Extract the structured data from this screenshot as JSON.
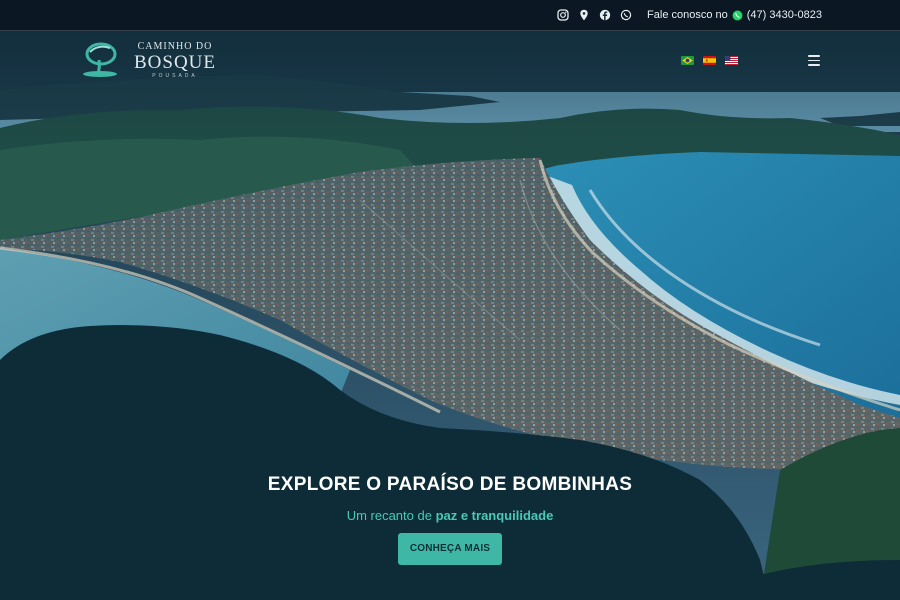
{
  "topbar": {
    "icons": [
      "instagram-icon",
      "map-pin-icon",
      "facebook-icon",
      "whatsapp-icon"
    ],
    "contact_label": "Fale conosco no",
    "contact_icon": "whatsapp-icon",
    "phone": "(47) 3430-0823"
  },
  "logo": {
    "line1": "CAMINHO DO",
    "line2": "BOSQUE",
    "line3": "POUSADA"
  },
  "languages": [
    {
      "name": "Português",
      "icon": "brazil-flag-icon"
    },
    {
      "name": "Español",
      "icon": "spain-flag-icon"
    },
    {
      "name": "English",
      "icon": "usa-flag-icon"
    }
  ],
  "menu_icon": "hamburger-menu-icon",
  "hero": {
    "title": "EXPLORE O PARAÍSO DE BOMBINHAS",
    "subtitle_prefix": "Um recanto de ",
    "subtitle_highlight": "paz e tranquilidade",
    "cta_label": "CONHEÇA MAIS"
  },
  "colors": {
    "accent": "#3fb7a7",
    "accent_text": "#49c9b8",
    "whatsapp": "#25d366",
    "overlay": "#0d2a37"
  }
}
